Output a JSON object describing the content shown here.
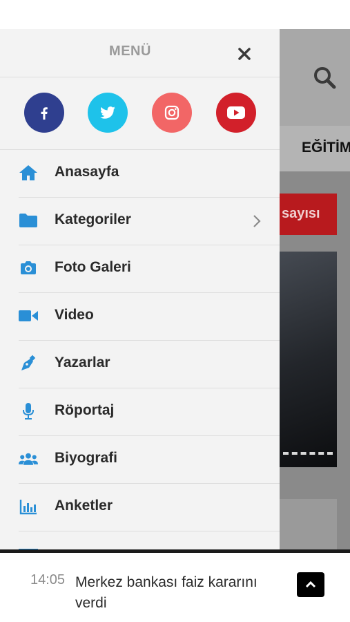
{
  "menu": {
    "title": "MENÜ",
    "social": [
      {
        "name": "facebook",
        "color": "#2f3f8f",
        "icon": "facebook-icon"
      },
      {
        "name": "twitter",
        "color": "#1ec2ea",
        "icon": "twitter-icon"
      },
      {
        "name": "instagram",
        "color": "#f26666",
        "icon": "instagram-icon"
      },
      {
        "name": "youtube",
        "color": "#d2202a",
        "icon": "youtube-icon"
      }
    ],
    "items": [
      {
        "label": "Anasayfa",
        "icon": "home-icon"
      },
      {
        "label": "Kategoriler",
        "icon": "folder-icon"
      },
      {
        "label": "Foto Galeri",
        "icon": "camera-icon"
      },
      {
        "label": "Video",
        "icon": "video-camera-icon"
      },
      {
        "label": "Yazarlar",
        "icon": "pen-icon"
      },
      {
        "label": "Röportaj",
        "icon": "microphone-icon"
      },
      {
        "label": "Biyografi",
        "icon": "users-icon"
      },
      {
        "label": "Anketler",
        "icon": "bar-chart-icon"
      }
    ],
    "accent_color": "#2a8fd6"
  },
  "background": {
    "nav_label": "EĞİTİM",
    "headline_partial": "sayısı"
  },
  "ticker": {
    "time": "14:05",
    "text": "Merkez bankası faiz kararını verdi"
  }
}
